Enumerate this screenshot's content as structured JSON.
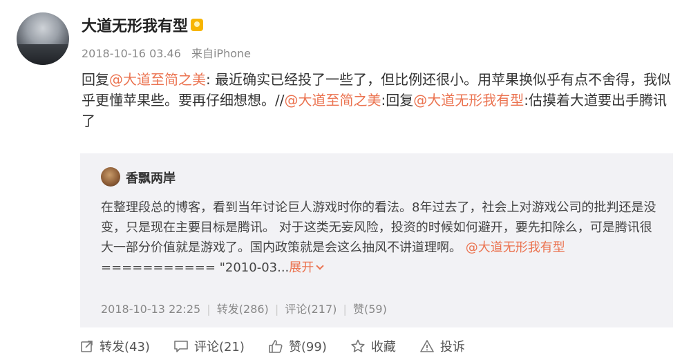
{
  "user": {
    "name": "大道无形我有型"
  },
  "meta": {
    "timestamp": "2018-10-16 03.46",
    "source": "来自iPhone"
  },
  "post": {
    "reply_prefix": "回复",
    "mention1": "@大道至简之美",
    "text1": ": 最近确实已经投了一些了，但比例还很小。用苹果换似乎有点不舍得，我似乎更懂苹果些。要再仔细想想。//",
    "mention2": "@大道至简之美",
    "text2": ":回复",
    "mention3": "@大道无形我有型",
    "text3": ":估摸着大道要出手腾讯了"
  },
  "repost": {
    "name": "香飘两岸",
    "text": "在整理段总的博客，看到当年讨论巨人游戏时你的看法。8年过去了，社会上对游戏公司的批判还是没变，只是现在主要目标是腾讯。 对于这类无妄风险，投资的时候如何避开，要先扣除么，可是腾讯很大一部分价值就是游戏了。国内政策就是会这么抽风不讲道理啊。 ",
    "mention": "@大道无形我有型",
    "tail": " =========== \"2010-03...",
    "expand_label": "展开",
    "timestamp": "2018-10-13 22:25",
    "repost_label": "转发(286)",
    "comment_label": "评论(217)",
    "like_label": "赞(59)"
  },
  "actions": {
    "repost": "转发(43)",
    "comment": "评论(21)",
    "like": "赞(99)",
    "favorite": "收藏",
    "report": "投诉"
  },
  "colors": {
    "mention": "#eb7350",
    "badge": "#f7b500",
    "repost_bg": "#f2f2f5"
  }
}
